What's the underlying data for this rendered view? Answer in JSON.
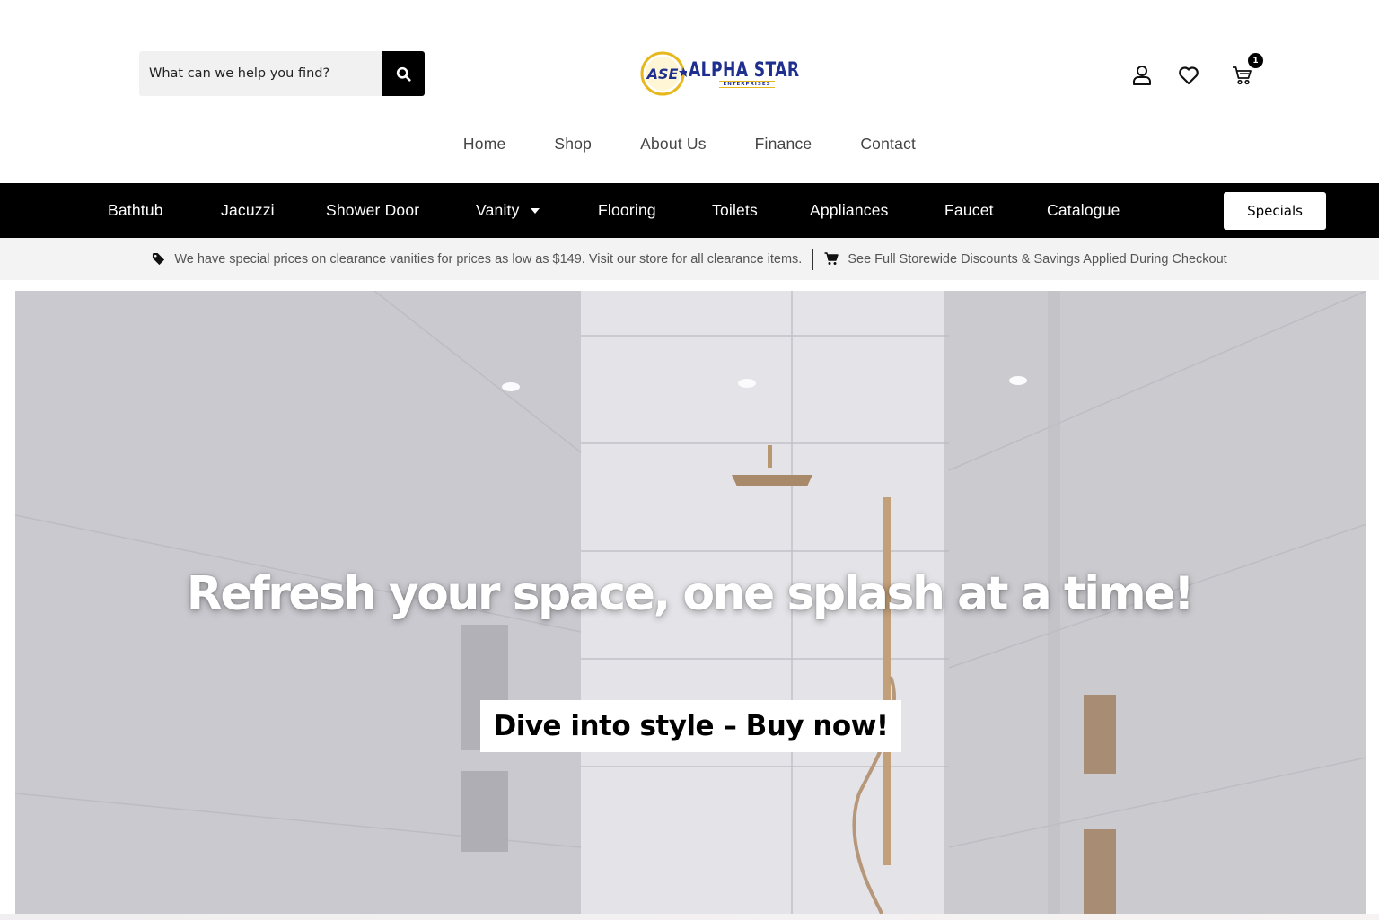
{
  "header": {
    "search": {
      "placeholder": "What can we help you find?",
      "icon": "search-icon"
    },
    "logo": {
      "mark_text": "ASE",
      "name": "ALPHA STAR",
      "sub": "ENTERPRISES"
    },
    "icons": {
      "account": "user-icon",
      "wishlist": "heart-icon",
      "cart": "cart-icon",
      "cart_count": "1"
    }
  },
  "main_nav": [
    {
      "label": "Home"
    },
    {
      "label": "Shop"
    },
    {
      "label": "About Us"
    },
    {
      "label": "Finance"
    },
    {
      "label": "Contact"
    }
  ],
  "category_bar": {
    "items": [
      {
        "label": "Bathtub"
      },
      {
        "label": "Jacuzzi"
      },
      {
        "label": "Shower Door"
      },
      {
        "label": "Vanity",
        "has_dropdown": true
      },
      {
        "label": "Flooring"
      },
      {
        "label": "Toilets"
      },
      {
        "label": "Appliances"
      },
      {
        "label": "Faucet"
      },
      {
        "label": "Catalogue"
      }
    ],
    "specials_label": "Specials"
  },
  "promo_strip": {
    "left": {
      "icon": "tag-icon",
      "text": "We have special prices on clearance vanities for prices as low as $149. Visit our store for all clearance items."
    },
    "right": {
      "icon": "cart-icon",
      "text": "See Full Storewide Discounts & Savings Applied During Checkout"
    }
  },
  "hero": {
    "title": "Refresh your space, one splash at a time!",
    "cta_label": "Dive into style – Buy now!"
  },
  "colors": {
    "nav_bar_bg": "#000000",
    "logo_blue": "#1f2f8f",
    "logo_gold": "#e7b81c",
    "promo_bg": "#f3f3f3"
  }
}
